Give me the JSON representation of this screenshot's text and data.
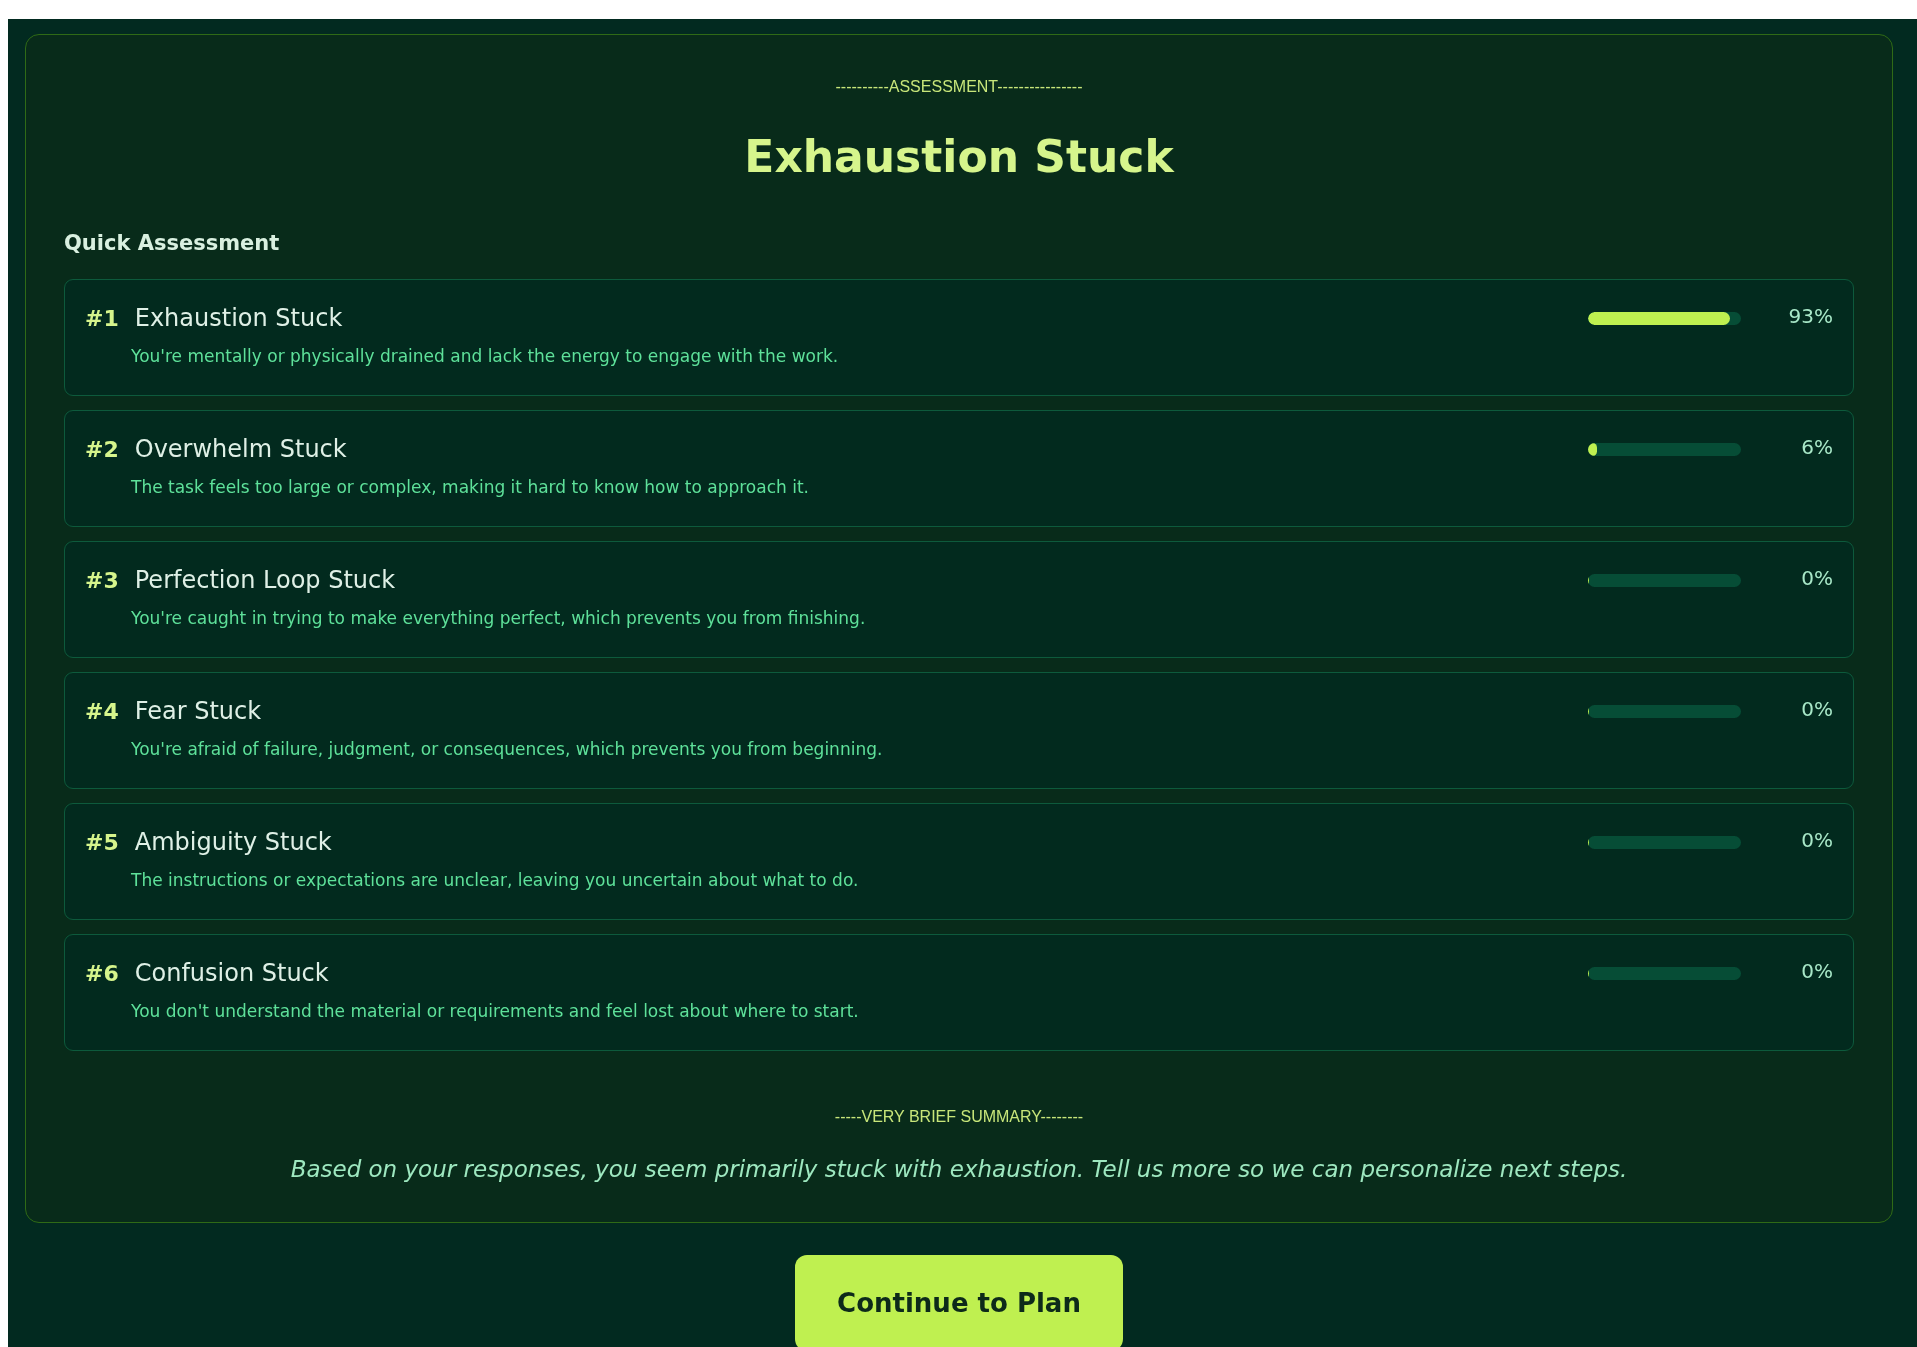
{
  "header_label": "----------ASSESSMENT----------------",
  "title": "Exhaustion Stuck",
  "section_title": "Quick Assessment",
  "results": [
    {
      "rank": "#1",
      "name": "Exhaustion Stuck",
      "description": "You're mentally or physically drained and lack the energy to engage with the work.",
      "level": 0.93,
      "percent": "93%"
    },
    {
      "rank": "#2",
      "name": "Overwhelm Stuck",
      "description": "The task feels too large or complex, making it hard to know how to approach it.",
      "level": 0.06,
      "percent": "6%"
    },
    {
      "rank": "#3",
      "name": "Perfection Loop Stuck",
      "description": "You're caught in trying to make everything perfect, which prevents you from finishing.",
      "level": 0,
      "percent": "0%"
    },
    {
      "rank": "#4",
      "name": "Fear Stuck",
      "description": "You're afraid of failure, judgment, or consequences, which prevents you from beginning.",
      "level": 0,
      "percent": "0%"
    },
    {
      "rank": "#5",
      "name": "Ambiguity Stuck",
      "description": "The instructions or expectations are unclear, leaving you uncertain about what to do.",
      "level": 0,
      "percent": "0%"
    },
    {
      "rank": "#6",
      "name": "Confusion Stuck",
      "description": "You don't understand the material or requirements and feel lost about where to start.",
      "level": 0,
      "percent": "0%"
    }
  ],
  "summary_label": "-----VERY BRIEF SUMMARY--------",
  "summary": "Based on your responses, you seem primarily stuck with exhaustion. Tell us more so we can personalize next steps.",
  "button": "Continue to Plan"
}
